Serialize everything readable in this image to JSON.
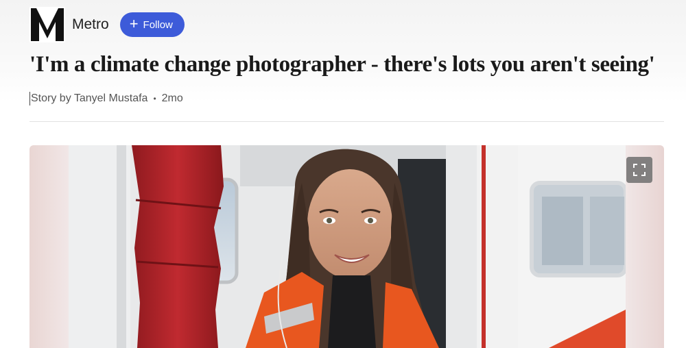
{
  "publisher": {
    "name": "Metro",
    "logo_letter": "M",
    "follow_label": "Follow",
    "follow_icon": "plus-icon"
  },
  "article": {
    "title": "'I'm a climate change photographer - there's lots you aren't seeing'",
    "byline": "Story by Tanyel Mustafa",
    "separator": "•",
    "age": "2mo"
  },
  "hero_image": {
    "expand_icon": "expand-icon"
  },
  "colors": {
    "follow_button": "#3d5bd9",
    "jacket_orange": "#e8571f",
    "bag_red": "#b3242a"
  }
}
